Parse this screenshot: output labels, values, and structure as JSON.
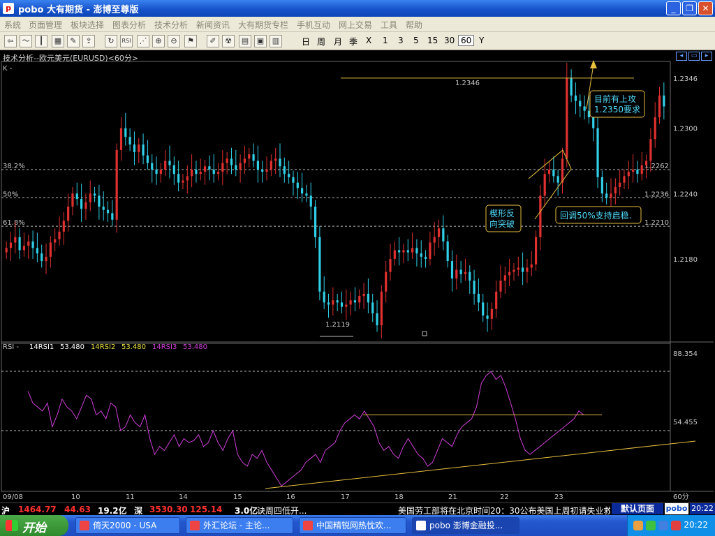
{
  "window": {
    "title": "pobo 大有期货 - 澎博至尊版",
    "app_icon": "pobo-logo-icon",
    "controls": [
      "minimize-icon",
      "restore-icon",
      "close-icon"
    ]
  },
  "menu": [
    "系统",
    "页面管理",
    "板块选择",
    "图表分析",
    "技术分析",
    "新闻资讯",
    "大有期货专栏",
    "手机互动",
    "网上交易",
    "工具",
    "帮助"
  ],
  "toolbar": {
    "icons": [
      "back-arrow-icon",
      "line-chart-icon",
      "candle-chart-icon",
      "grid-icon",
      "notes-icon",
      "export-icon",
      "refresh-icon",
      "rsi-icon",
      "drawing-icon",
      "zoom-in-icon",
      "zoom-out-icon",
      "alert-icon",
      "pen-icon",
      "warning-icon",
      "book-icon",
      "package-icon"
    ],
    "rsi_label": "RSI",
    "periods": [
      "日",
      "周",
      "月",
      "季",
      "X",
      "1",
      "3",
      "5",
      "15",
      "30",
      "60",
      "Y"
    ],
    "selected_period": "60"
  },
  "chart": {
    "title": "技术分析--欧元美元(EURUSD)<60分>",
    "panel_label": "K -",
    "fib_levels": [
      {
        "label": "38.2%",
        "value": "1.2262"
      },
      {
        "label": "50%",
        "value": "1.2236"
      },
      {
        "label": "61.8%",
        "value": "1.2210"
      }
    ],
    "high_label": "1.2346",
    "low_label": "1.2119",
    "annotations": {
      "target": "目前有上攻\n1.2350要求",
      "wedge": "楔形反\n向突破",
      "retrace": "回调50%支持启稳."
    },
    "rsi_header": {
      "name": "RSI -",
      "rsi1_label": "14RSI1",
      "rsi1_value": "53.480",
      "rsi2_label": "14RSI2",
      "rsi2_value": "53.480",
      "rsi3_label": "14RSI3",
      "rsi3_value": "53.480"
    },
    "rsi_axis": [
      "88.354",
      "54.455"
    ],
    "date_labels": [
      "09/08",
      "10",
      "11",
      "14",
      "15",
      "16",
      "17",
      "18",
      "21",
      "22",
      "23"
    ],
    "period_unit": "60分",
    "colors": {
      "up": "#e03030",
      "down": "#30d0e8",
      "rsi": "#d040d8",
      "trend": "#e8c040",
      "annotation": "#f0d040"
    }
  },
  "chart_data": {
    "type": "candlestick",
    "price_axis": [
      "1.2346",
      "1.2300",
      "1.2262",
      "1.2236",
      "1.2240",
      "1.2210",
      "1.2180"
    ],
    "ylim": [
      1.2105,
      1.236
    ],
    "y_ticks": [
      1.218,
      1.224,
      1.23
    ],
    "y_tick_labels": [
      "1.2180",
      "1.2240",
      "1.2300"
    ],
    "fib": [
      1.2262,
      1.2236,
      1.221
    ],
    "resistance": 1.2346,
    "close_path": [
      1.219,
      1.2195,
      1.22,
      1.2188,
      1.2192,
      1.2196,
      1.219,
      1.2185,
      1.2178,
      1.2182,
      1.2195,
      1.2198,
      1.2205,
      1.2215,
      1.2228,
      1.224,
      1.2235,
      1.2226,
      1.2232,
      1.224,
      1.2238,
      1.2228,
      1.2225,
      1.2222,
      1.2216,
      1.228,
      1.23,
      1.2292,
      1.2285,
      1.2278,
      1.2285,
      1.2275,
      1.2268,
      1.2262,
      1.2258,
      1.2262,
      1.227,
      1.2266,
      1.2258,
      1.225,
      1.2252,
      1.2256,
      1.2262,
      1.2258,
      1.226,
      1.2265,
      1.2262,
      1.2258,
      1.226,
      1.2268,
      1.2272,
      1.2266,
      1.2262,
      1.2268,
      1.2272,
      1.2276,
      1.227,
      1.2262,
      1.226,
      1.2262,
      1.227,
      1.2272,
      1.2265,
      1.2258,
      1.2255,
      1.225,
      1.2245,
      1.224,
      1.2238,
      1.2228,
      1.22,
      1.215,
      1.214,
      1.2138,
      1.2142,
      1.214,
      1.2136,
      1.2138,
      1.2142,
      1.214,
      1.2146,
      1.2148,
      1.214,
      1.213,
      1.2119,
      1.215,
      1.2168,
      1.218,
      1.2188,
      1.2186,
      1.2188,
      1.2186,
      1.219,
      1.2185,
      1.2182,
      1.218,
      1.2195,
      1.22,
      1.2208,
      1.2196,
      1.2178,
      1.2162,
      1.217,
      1.2166,
      1.2168,
      1.216,
      1.2148,
      1.214,
      1.2128,
      1.2125,
      1.2134,
      1.215,
      1.216,
      1.2165,
      1.2168,
      1.217,
      1.2172,
      1.2168,
      1.2172,
      1.2175,
      1.22,
      1.2238,
      1.2258,
      1.2262,
      1.2256,
      1.225,
      1.2272,
      1.2346,
      1.233,
      1.2325,
      1.232,
      1.2316,
      1.231,
      1.23,
      1.2255,
      1.224,
      1.2236,
      1.224,
      1.2246,
      1.225,
      1.2256,
      1.226,
      1.2262,
      1.2258,
      1.2266,
      1.227,
      1.229,
      1.231,
      1.233,
      1.232
    ],
    "rsi_ylim": [
      30,
      100
    ],
    "rsi_path": [
      80,
      74,
      72,
      70,
      74,
      62,
      68,
      76,
      72,
      70,
      66,
      72,
      78,
      76,
      68,
      70,
      66,
      74,
      72,
      60,
      62,
      68,
      64,
      62,
      68,
      56,
      48,
      52,
      50,
      54,
      58,
      52,
      56,
      54,
      55,
      58,
      52,
      54,
      60,
      54,
      50,
      56,
      60,
      48,
      44,
      42,
      48,
      46,
      50,
      44,
      40,
      36,
      32,
      34,
      36,
      38,
      40,
      44,
      46,
      48,
      44,
      50,
      52,
      54,
      60,
      64,
      66,
      68,
      66,
      70,
      66,
      62,
      54,
      50,
      52,
      48,
      46,
      52,
      56,
      52,
      48,
      46,
      42,
      44,
      50,
      56,
      54,
      52,
      58,
      62,
      64,
      66,
      72,
      84,
      88,
      90,
      86,
      88,
      82,
      74,
      66,
      56,
      50,
      48,
      50,
      52,
      54,
      56,
      58,
      60,
      62,
      64,
      66,
      70,
      68
    ],
    "rsi_line": 68
  },
  "quote_bar": {
    "sh_label": "沪",
    "sh_value": "1464.77",
    "sh_change": "44.63",
    "sh_volume": "19.2亿",
    "sz_label": "深",
    "sz_value": "3530.30",
    "sz_change": "125.14",
    "sz_volume": "3.0亿",
    "sz_extra": "诀周四低开...",
    "ticker": "美国劳工部将在北京时间20：30公布美国上周初请失业救",
    "default_page": "默认页面",
    "brand": "pobo",
    "time": "20:22"
  },
  "taskbar": {
    "start_label": "开始",
    "tasks": [
      "倚天2000 - USA",
      "外汇论坛 - 主论...",
      "中国精锐网热忱欢...",
      "pobo 澎博金融投..."
    ],
    "tray_time": "20:22"
  }
}
